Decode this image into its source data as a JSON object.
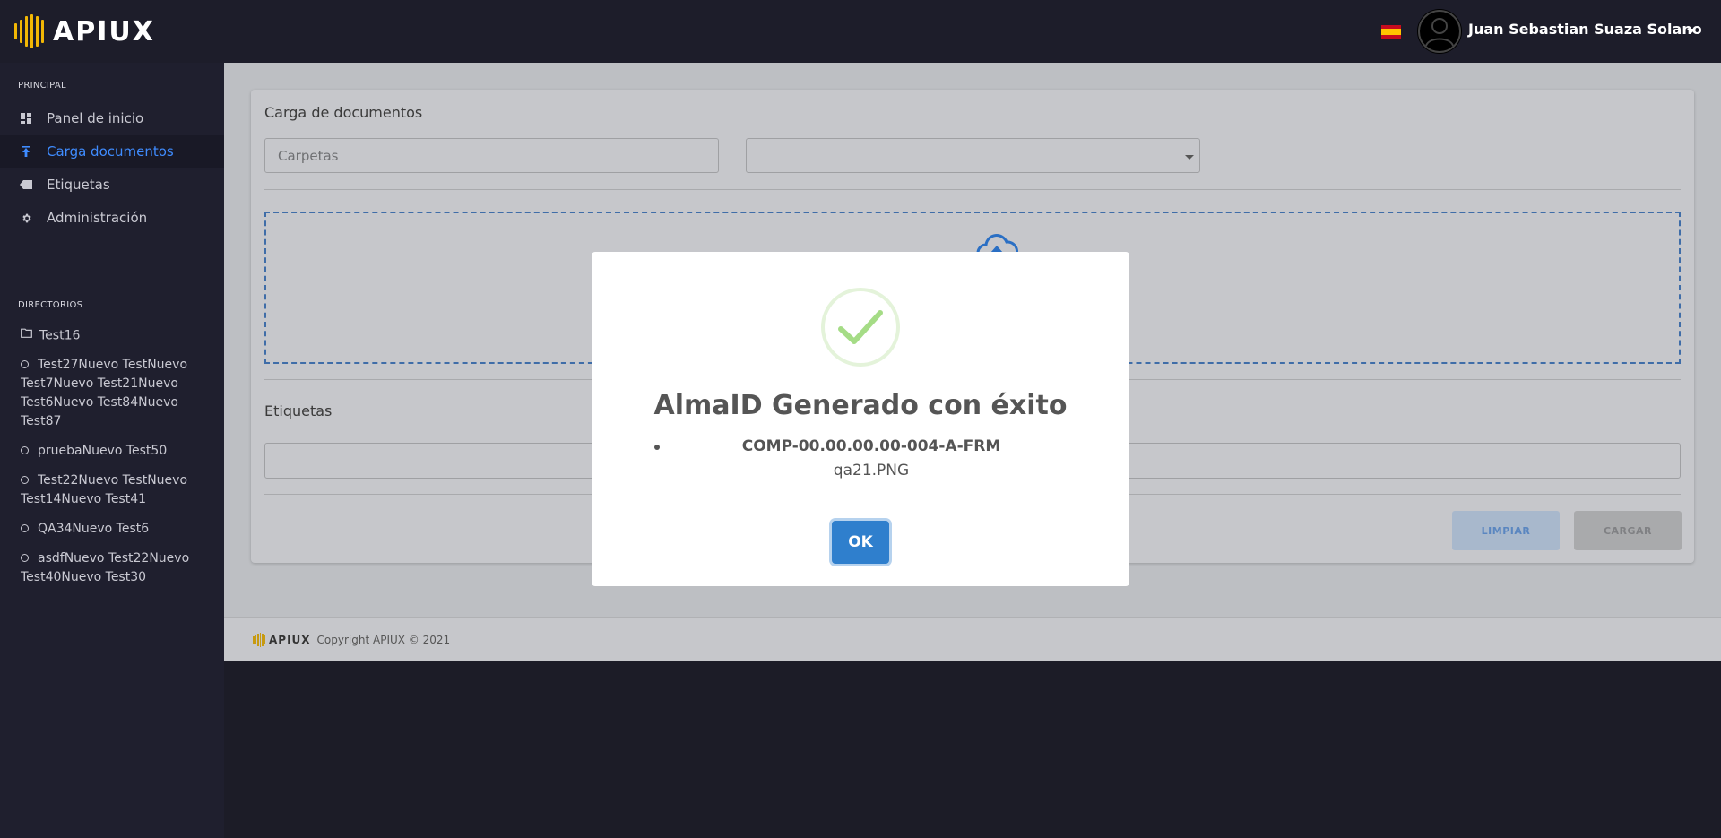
{
  "header": {
    "logo_text": "APIUX",
    "user_name": "Juan Sebastian Suaza Solano",
    "brand_color": "#f2b705"
  },
  "sidebar": {
    "principal_label": "PRINCIPAL",
    "items": [
      {
        "label": "Panel de inicio",
        "icon": "dashboard-icon"
      },
      {
        "label": "Carga documentos",
        "icon": "upload-icon",
        "active": true
      },
      {
        "label": "Etiquetas",
        "icon": "tag-icon"
      },
      {
        "label": "Administración",
        "icon": "gear-icon"
      }
    ],
    "directorios_label": "DIRECTORIOS",
    "directories": [
      {
        "label": "Test16",
        "icon": "folder-icon"
      },
      {
        "label": "Test27Nuevo TestNuevo Test7Nuevo Test21Nuevo Test6Nuevo Test84Nuevo Test87",
        "icon": "circle-icon"
      },
      {
        "label": "pruebaNuevo Test50",
        "icon": "circle-icon"
      },
      {
        "label": "Test22Nuevo TestNuevo Test14Nuevo Test41",
        "icon": "circle-icon"
      },
      {
        "label": "QA34Nuevo Test6",
        "icon": "circle-icon"
      },
      {
        "label": "asdfNuevo Test22Nuevo Test40Nuevo Test30",
        "icon": "circle-icon"
      }
    ]
  },
  "main": {
    "card_title": "Carga de documentos",
    "carpetas_placeholder": "Carpetas",
    "etiquetas_title": "Etiquetas",
    "limpiar_label": "LIMPIAR",
    "cargar_label": "CARGAR"
  },
  "footer": {
    "logo_text": "APIUX",
    "copyright": "Copyright APIUX © 2021"
  },
  "modal": {
    "title": "AlmaID Generado con éxito",
    "code": "COMP-00.00.00.00-004-A-FRM",
    "file": "qa21.PNG",
    "ok_label": "OK",
    "success_color": "#a5dc86",
    "button_color": "#2f7fcd"
  }
}
